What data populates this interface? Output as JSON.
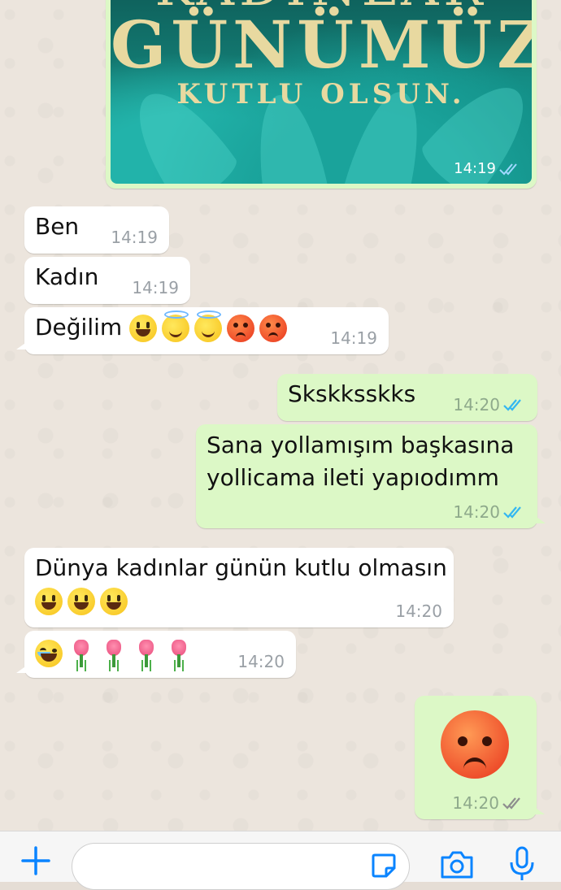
{
  "media_message": {
    "title_line1": "KADINLAR",
    "title_line2": "GÜNÜMÜZ",
    "title_line3": "KUTLU OLSUN.",
    "time": "14:19",
    "status": "read"
  },
  "messages": [
    {
      "direction": "in",
      "text": "Ben",
      "time": "14:19"
    },
    {
      "direction": "in",
      "text": "Kadın",
      "time": "14:19"
    },
    {
      "direction": "in",
      "text": "Değilim",
      "emojis": [
        "grinning-face",
        "smiling-face-with-halo",
        "smiling-face-with-halo",
        "angry-face",
        "angry-face"
      ],
      "time": "14:19"
    },
    {
      "direction": "out",
      "text": "Skskksskks",
      "time": "14:20",
      "status": "read"
    },
    {
      "direction": "out",
      "text": "Sana yollamışım başkasına yollicama ileti yapıodımm",
      "time": "14:20",
      "status": "read"
    },
    {
      "direction": "in",
      "text": "Dünya kadınlar günün kutlu olmasın",
      "emojis": [
        "grinning-face",
        "grinning-face",
        "grinning-face"
      ],
      "time": "14:20"
    },
    {
      "direction": "in",
      "text": "",
      "emojis": [
        "face-with-tears-of-joy",
        "tulip",
        "tulip",
        "tulip",
        "tulip"
      ],
      "time": "14:20"
    },
    {
      "direction": "out",
      "text": "",
      "emojis": [
        "angry-face"
      ],
      "time": "14:20",
      "status": "delivered"
    }
  ],
  "composer": {
    "placeholder": "",
    "icons": [
      "plus-icon",
      "sticker-icon",
      "camera-icon",
      "microphone-icon"
    ]
  },
  "colors": {
    "incoming_bubble": "#ffffff",
    "outgoing_bubble": "#dcf8c6",
    "read_tick": "#34b7f1",
    "delivered_tick": "#8e8e8e",
    "accent": "#0a84ff",
    "chat_background": "#ece5dd"
  }
}
